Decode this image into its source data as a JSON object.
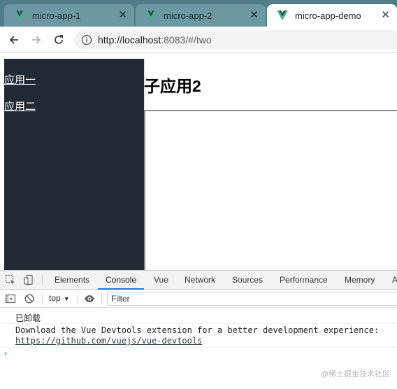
{
  "browser": {
    "tabs": [
      {
        "title": "micro-app-1",
        "active": false
      },
      {
        "title": "micro-app-2",
        "active": false
      },
      {
        "title": "micro-app-demo",
        "active": true
      }
    ],
    "close_glyph": "✕",
    "url": {
      "host": "http://localhost",
      "rest": ":8083/#/two"
    }
  },
  "page": {
    "nav_links": [
      "应用一",
      "应用二"
    ],
    "title": "子应用2"
  },
  "devtools": {
    "tabs": [
      "Elements",
      "Console",
      "Vue",
      "Network",
      "Sources",
      "Performance",
      "Memory",
      "A"
    ],
    "active_tab": "Console",
    "context": "top",
    "filter_placeholder": "Filter",
    "messages": [
      {
        "text": "已卸载"
      },
      {
        "text": "Download the Vue Devtools extension for a better development experience:",
        "link": "https://github.com/vuejs/vue-devtools"
      }
    ],
    "prompt": "›"
  },
  "watermark": "@稀土掘金技术社区",
  "colors": {
    "tabstrip": "#4f7d8a",
    "sidebar": "#222a35",
    "vue_green": "#41b883",
    "vue_dark": "#35495e",
    "devtools_accent": "#1a73e8"
  }
}
